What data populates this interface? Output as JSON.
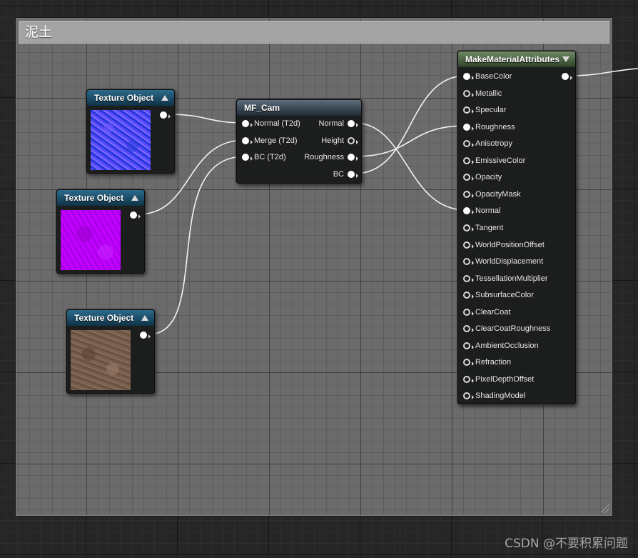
{
  "comment": {
    "title": "泥土"
  },
  "texture_nodes": [
    {
      "title": "Texture Object",
      "thumbnail": "normal-map-blue"
    },
    {
      "title": "Texture Object",
      "thumbnail": "mask-map-purple"
    },
    {
      "title": "Texture Object",
      "thumbnail": "dirt-base-color"
    }
  ],
  "mf_cam": {
    "title": "MF_Cam",
    "inputs": [
      "Normal (T2d)",
      "Merge (T2d)",
      "BC (T2d)"
    ],
    "outputs": [
      "Normal",
      "Height",
      "Roughness",
      "BC"
    ]
  },
  "make_material_attributes": {
    "title": "MakeMaterialAttributes",
    "inputs": [
      "BaseColor",
      "Metallic",
      "Specular",
      "Roughness",
      "Anisotropy",
      "EmissiveColor",
      "Opacity",
      "OpacityMask",
      "Normal",
      "Tangent",
      "WorldPositionOffset",
      "WorldDisplacement",
      "TessellationMultiplier",
      "SubsurfaceColor",
      "ClearCoat",
      "ClearCoatRoughness",
      "AmbientOcclusion",
      "Refraction",
      "PixelDepthOffset",
      "ShadingModel"
    ],
    "connected_inputs": [
      "BaseColor",
      "Roughness",
      "Normal"
    ]
  },
  "watermark": "CSDN @不要积累问题",
  "colors": {
    "texture_header": "#1f4f6a",
    "mf_header": "#3a4753",
    "mma_header": "#4c6644",
    "comment_title_bar": "#a3a3a3",
    "wire": "#ffffff"
  }
}
